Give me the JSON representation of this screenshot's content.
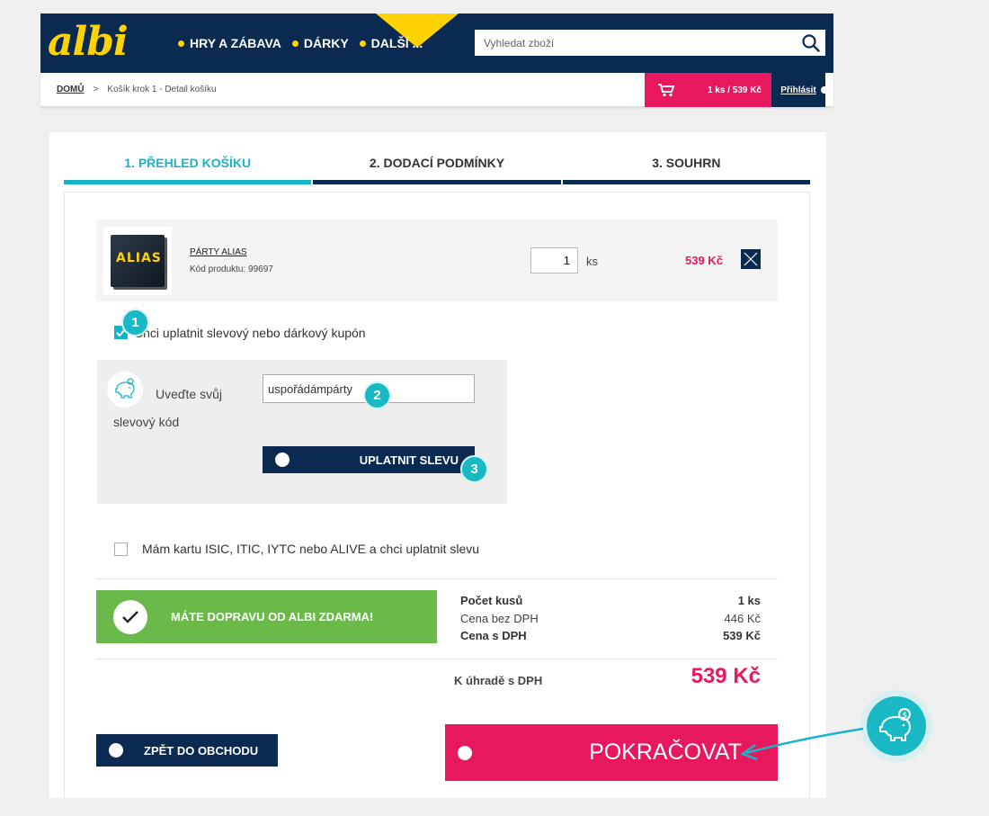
{
  "header": {
    "logo_text": "albi",
    "nav": [
      "HRY A ZÁBAVA",
      "DÁRKY",
      "DALŠÍ ..."
    ],
    "search_placeholder": "Vyhledat zboží"
  },
  "breadcrumb": {
    "home": "DOMŮ",
    "separator": ">",
    "current": "Košík krok 1 - Detail košíku"
  },
  "cart_summary": "1 ks / 539 Kč",
  "login": "Přihlásit",
  "steps": [
    "1. PŘEHLED KOŠÍKU",
    "2. DODACÍ PODMÍNKY",
    "3. SOUHRN"
  ],
  "product": {
    "name": "PÁRTY ALIAS",
    "code_label": "Kód produktu: 99697",
    "image_text": "ALIAS",
    "quantity": "1",
    "unit": "ks",
    "price": "539 Kč"
  },
  "coupon": {
    "checkbox_label": "Chci uplatnit slevový nebo dárkový kupón",
    "field_label": "Uveďte svůj slevový kód",
    "code_value": "uspořádámpárty",
    "apply_button": "UPLATNIT SLEVU"
  },
  "isic": {
    "checkbox_label": "Mám kartu ISIC, ITIC, IYTC nebo ALIVE a chci uplatnit slevu"
  },
  "free_shipping": "MÁTE DOPRAVU OD ALBI ZDARMA!",
  "summary": {
    "rows": [
      {
        "label": "Počet kusů",
        "value": "1 ks"
      },
      {
        "label": "Cena bez DPH",
        "value": "446 Kč"
      },
      {
        "label": "Cena s DPH",
        "value": "539 Kč"
      }
    ],
    "total_label": "K úhradě s DPH",
    "total_value": "539 Kč"
  },
  "buttons": {
    "back": "ZPĚT DO OBCHODU",
    "continue": "POKRAČOVAT"
  },
  "badges": [
    "1",
    "2",
    "3"
  ],
  "colors": {
    "navy": "#0b2a52",
    "yellow": "#ffd200",
    "pink": "#e8185e",
    "teal": "#17b4c8",
    "green": "#6ab94a"
  }
}
